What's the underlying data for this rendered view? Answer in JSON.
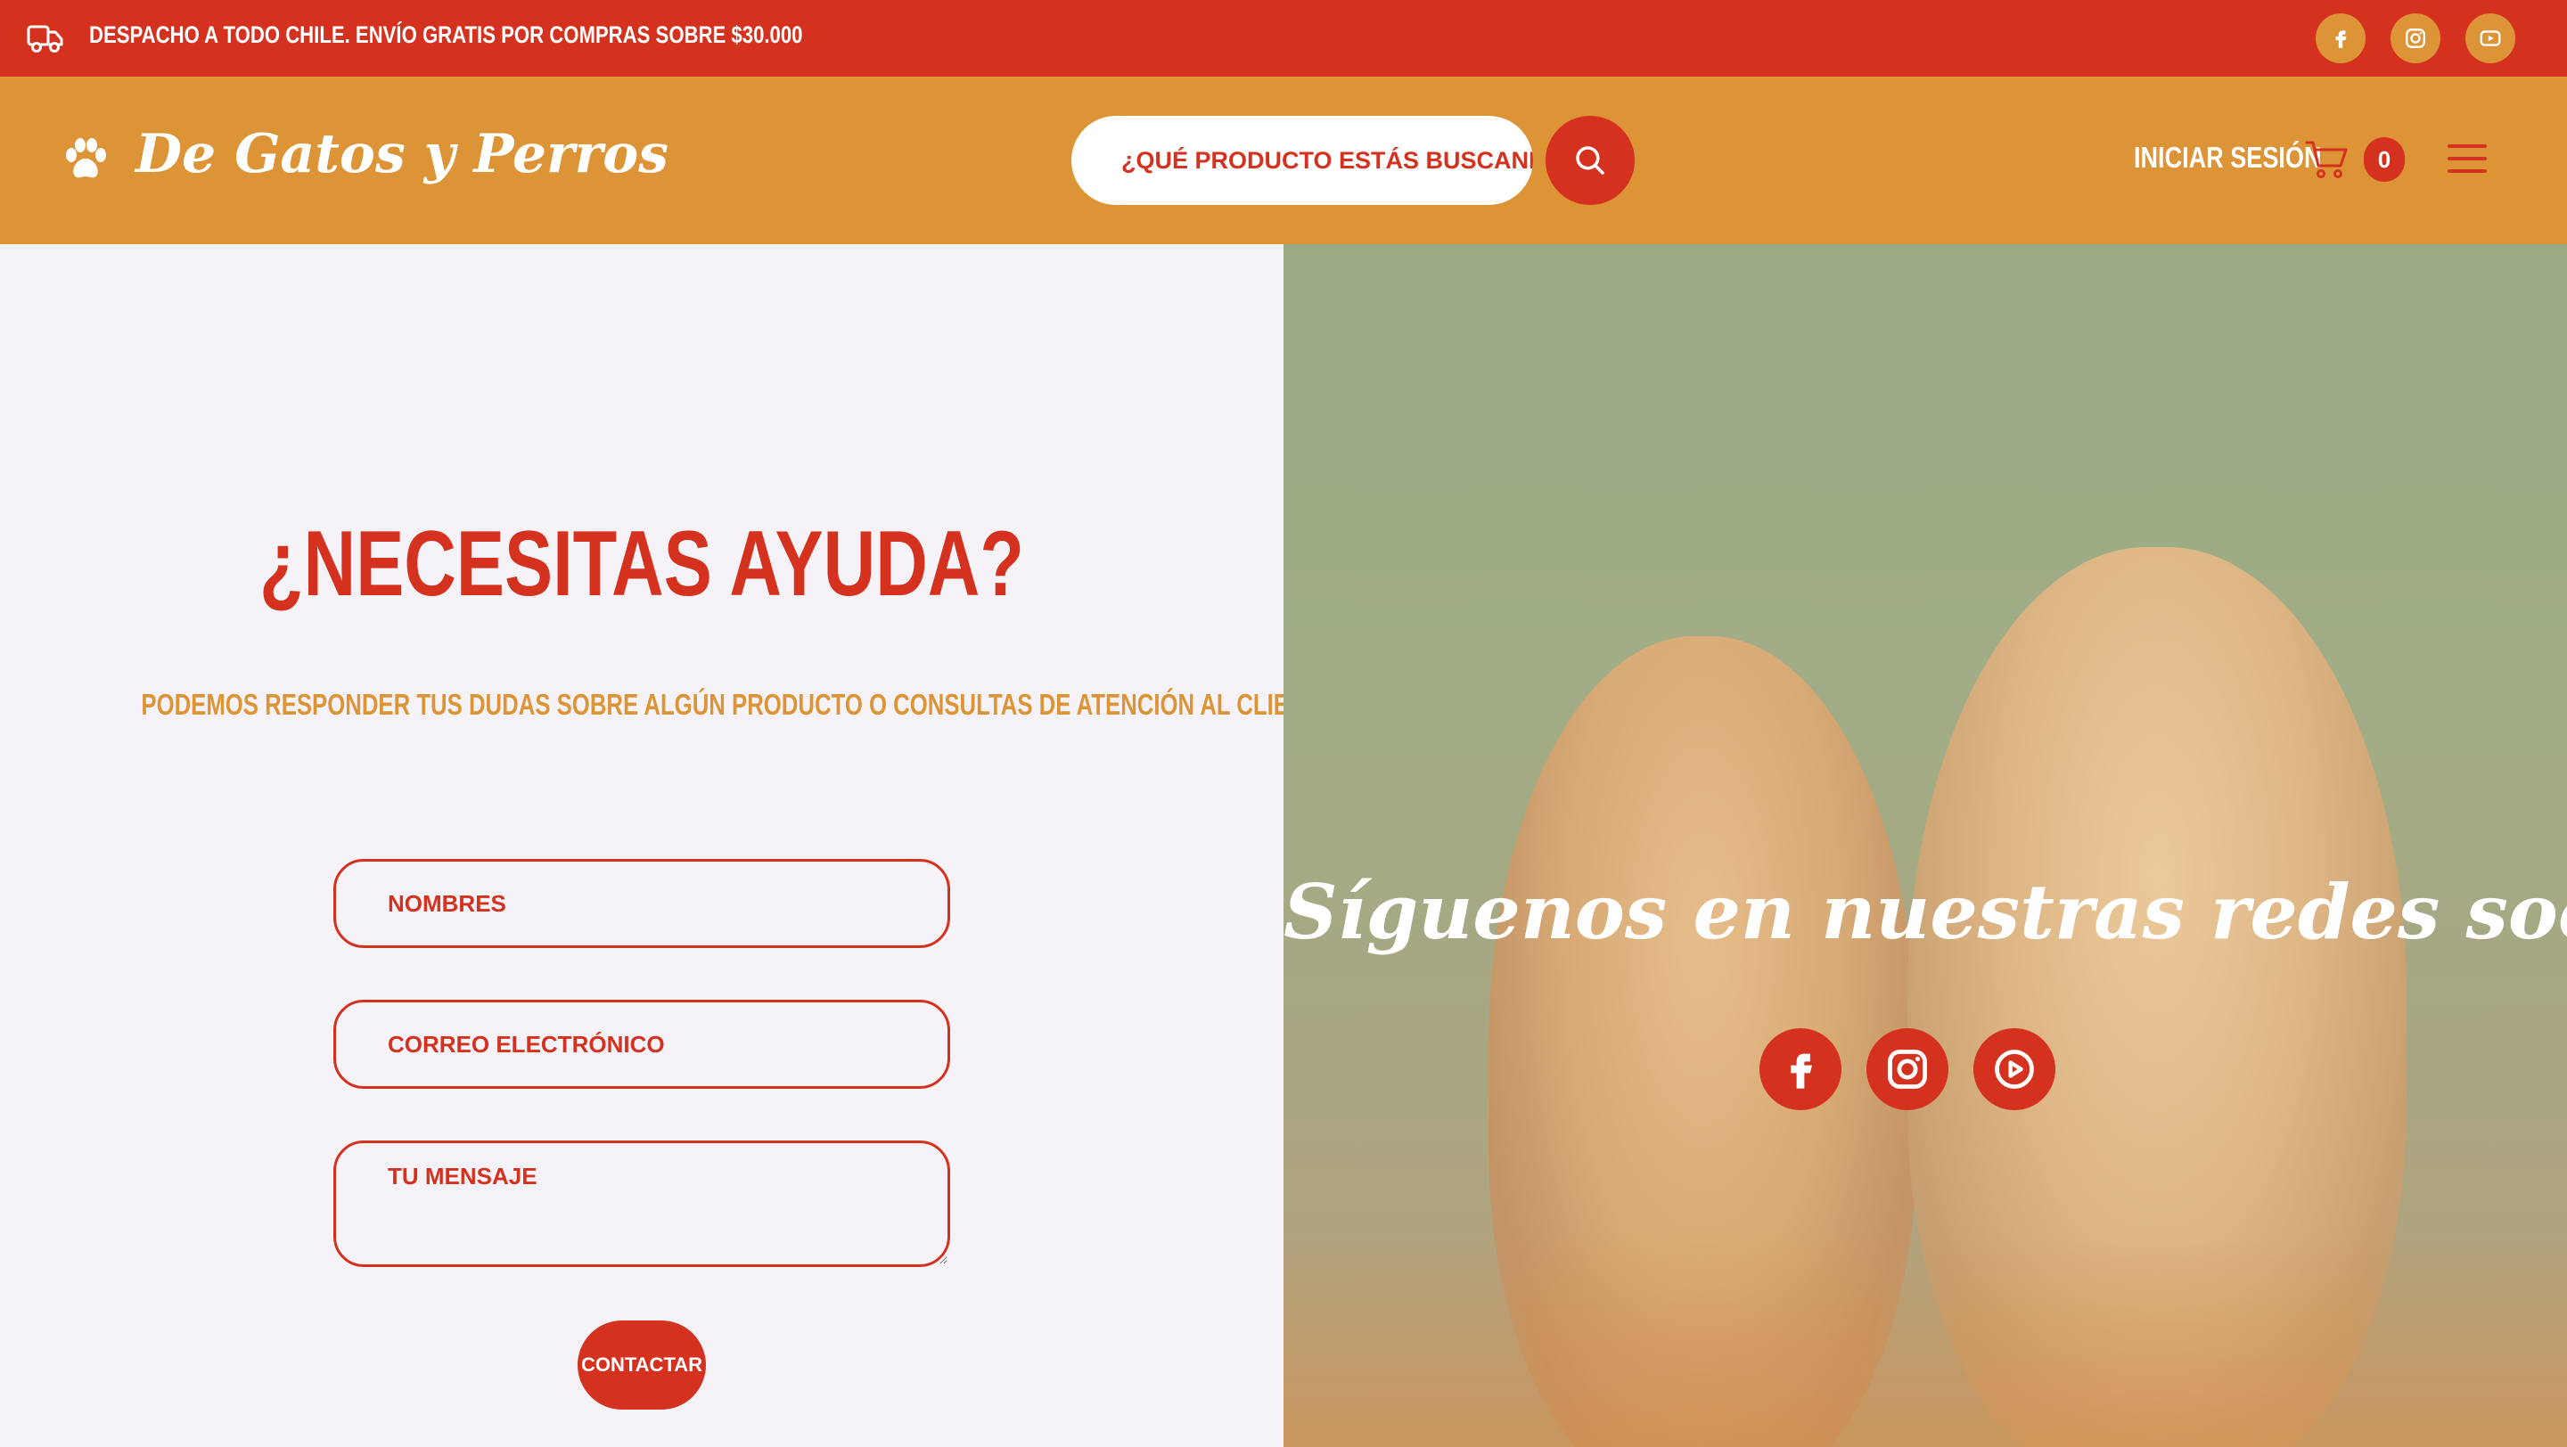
{
  "topbar": {
    "shipping_text": "DESPACHO A TODO CHILE. ENVÍO GRATIS POR COMPRAS SOBRE $30.000",
    "social": [
      "facebook-icon",
      "instagram-icon",
      "youtube-icon"
    ]
  },
  "header": {
    "logo_text": "De Gatos y Perros",
    "search_placeholder": "¿QUÉ PRODUCTO ESTÁS BUSCANDO?",
    "login_label": "INICIAR SESIÓN",
    "cart_count": "0"
  },
  "contact": {
    "title": "¿NECESITAS AYUDA?",
    "subtitle": "PODEMOS RESPONDER TUS DUDAS SOBRE ALGÚN PRODUCTO O CONSULTAS DE ATENCIÓN AL CLIENTE, ESCRÍBENOS!",
    "name_placeholder": "NOMBRES",
    "email_placeholder": "CORREO ELECTRÓNICO",
    "message_placeholder": "TU MENSAJE",
    "submit_label": "CONTACTAR"
  },
  "follow": {
    "text": "Síguenos en nuestras redes sociales"
  },
  "colors": {
    "red": "#d4311f",
    "orange": "#dd9436",
    "background": "#f6f3f8"
  }
}
